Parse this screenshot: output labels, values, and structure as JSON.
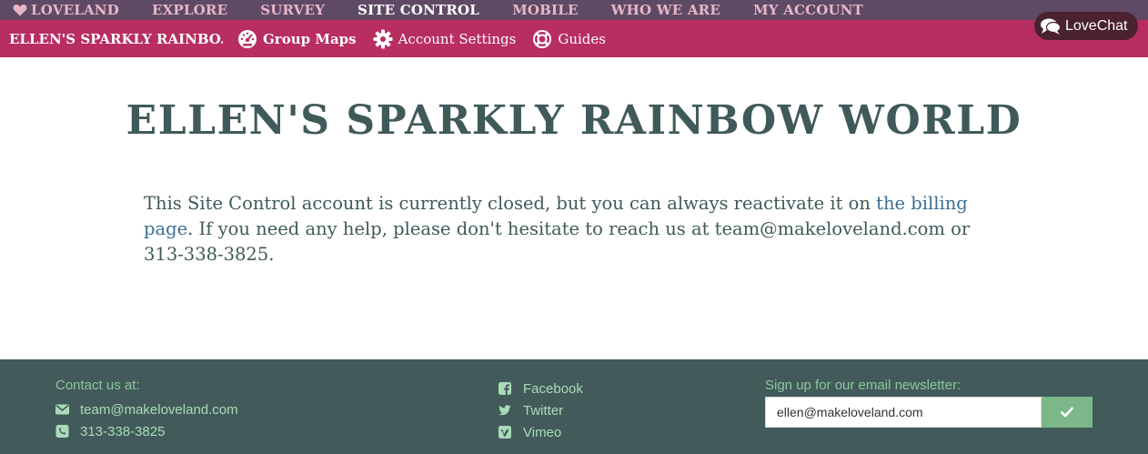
{
  "topnav": {
    "items": [
      {
        "label": "LOVELAND",
        "icon": "heart-icon"
      },
      {
        "label": "EXPLORE"
      },
      {
        "label": "SURVEY"
      },
      {
        "label": "SITE CONTROL",
        "active": true
      },
      {
        "label": "MOBILE"
      },
      {
        "label": "WHO WE ARE"
      },
      {
        "label": "MY ACCOUNT"
      }
    ]
  },
  "lovechat": {
    "label": "LoveChat",
    "icon": "chat-bubble-icon"
  },
  "subnav": {
    "site_name": "ELLEN'S SPARKLY RAINBO...",
    "links": [
      {
        "label": "Group Maps",
        "icon": "dashboard-icon"
      },
      {
        "label": "Account Settings",
        "icon": "gear-icon"
      },
      {
        "label": "Guides",
        "icon": "lifebuoy-icon"
      }
    ]
  },
  "main": {
    "title": "ELLEN'S SPARKLY RAINBOW WORLD",
    "message_before": "This Site Control account is currently closed, but you can always reactivate it on ",
    "message_link": "the billing page",
    "message_after": ". If you need any help, please don't hesitate to reach us at team@makeloveland.com or 313-338-3825."
  },
  "footer": {
    "contact_heading": "Contact us at:",
    "email": "team@makeloveland.com",
    "phone": "313-338-3825",
    "social": [
      {
        "label": "Facebook",
        "icon": "facebook-icon"
      },
      {
        "label": "Twitter",
        "icon": "twitter-icon"
      },
      {
        "label": "Vimeo",
        "icon": "vimeo-icon"
      }
    ],
    "newsletter_heading": "Sign up for our email newsletter:",
    "newsletter_value": "ellen@makeloveland.com"
  },
  "colors": {
    "topnav_bg": "#5f4a66",
    "subnav_bg": "#b82e60",
    "title_text": "#3f5a59",
    "link_text": "#3b6f94",
    "footer_bg": "#435a5a",
    "footer_accent": "#8cc79f",
    "submit_button": "#7bb788"
  }
}
